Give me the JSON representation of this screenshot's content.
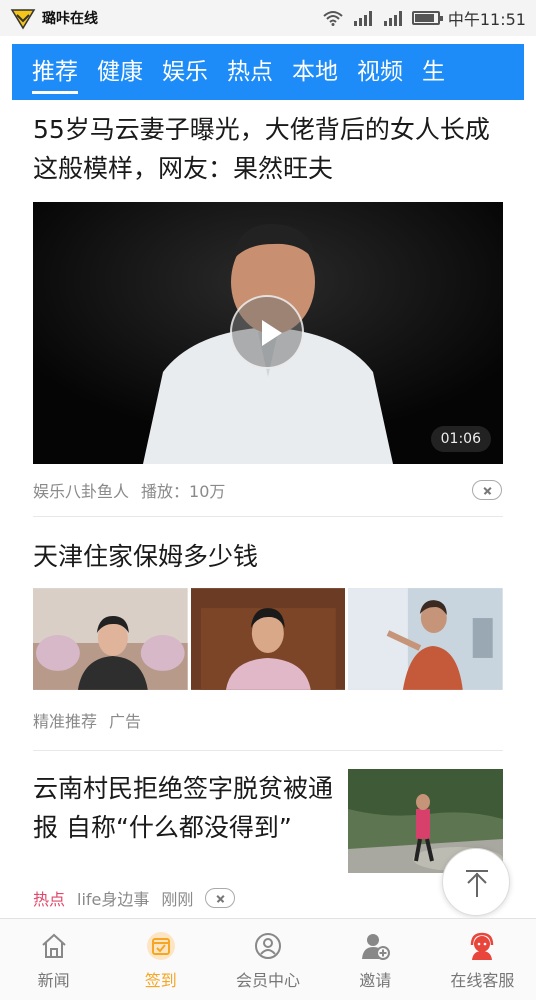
{
  "status_bar": {
    "app_name": "璐咔在线",
    "time": "中午11:51",
    "battery_level": 0.85,
    "icons": [
      "app-logo-icon",
      "wifi-icon",
      "signal-icon",
      "signal-icon",
      "battery-icon"
    ]
  },
  "tabs": [
    {
      "label": "推荐",
      "active": true
    },
    {
      "label": "健康"
    },
    {
      "label": "娱乐"
    },
    {
      "label": "热点"
    },
    {
      "label": "本地"
    },
    {
      "label": "视频"
    },
    {
      "label": "生"
    }
  ],
  "articles": [
    {
      "title": "55岁马云妻子曝光，大佬背后的女人长成这般模样，网友：果然旺夫",
      "video_duration": "01:06",
      "source": "娱乐八卦鱼人",
      "plays": "播放：10万"
    },
    {
      "title": "天津住家保姆多少钱",
      "tag1": "精准推荐",
      "tag2": "广告"
    },
    {
      "title": "云南村民拒绝签字脱贫被通报 自称“什么都没得到”",
      "hot_label": "热点",
      "source": "life身边事",
      "time": "刚刚"
    }
  ],
  "nav": [
    {
      "label": "新闻",
      "icon": "home-icon"
    },
    {
      "label": "签到",
      "icon": "calendar-check-icon",
      "active": true
    },
    {
      "label": "会员中心",
      "icon": "user-circle-icon"
    },
    {
      "label": "邀请",
      "icon": "add-user-icon"
    },
    {
      "label": "在线客服",
      "icon": "customer-service-icon"
    }
  ],
  "colors": {
    "tab_bar": "#1d8cf8",
    "hot": "#e1476a",
    "nav_active": "#f5a623",
    "service_icon": "#e8463c"
  }
}
